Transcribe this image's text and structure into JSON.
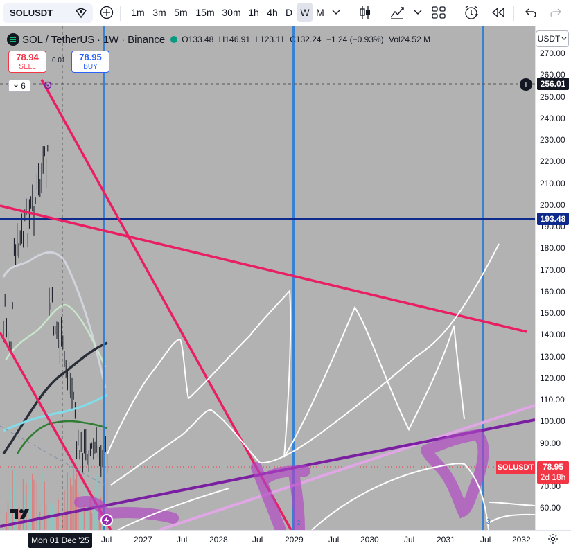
{
  "toolbar": {
    "symbol": "SOLUSDT",
    "intervals": [
      "1m",
      "3m",
      "5m",
      "15m",
      "30m",
      "1h",
      "4h",
      "D",
      "W",
      "M"
    ],
    "active_interval": "W"
  },
  "legend": {
    "pair": "SOL / TetherUS",
    "interval": "1W",
    "exchange": "Binance",
    "o_label": "O",
    "o": "133.48",
    "h_label": "H",
    "h": "146.91",
    "l_label": "L",
    "l": "123.11",
    "c_label": "C",
    "c": "132.24",
    "change": "−1.24 (−0.93%)",
    "vol_label": "Vol",
    "vol": "24.52 M"
  },
  "trade": {
    "sell_price": "78.94",
    "sell_label": "SELL",
    "buy_price": "78.95",
    "buy_label": "BUY",
    "spread": "0.01"
  },
  "indicators_count": "6",
  "right_axis": {
    "currency": "USDT",
    "ticks": [
      "270.00",
      "260.00",
      "250.00",
      "240.00",
      "230.00",
      "220.00",
      "210.00",
      "200.00",
      "190.00",
      "180.00",
      "170.00",
      "160.00",
      "150.00",
      "140.00",
      "130.00",
      "120.00",
      "110.00",
      "100.00",
      "90.00",
      "80.00",
      "70.00",
      "60.00"
    ],
    "crosshair_price": "256.01",
    "level_price": "193.48",
    "last_price": "78.95",
    "countdown": "2d 18h",
    "symbol_flag": "SOLUSDT"
  },
  "bottom_axis": {
    "crosshair_date": "Mon 01 Dec '25",
    "ticks": [
      "Jul",
      "2027",
      "Jul",
      "2028",
      "Jul",
      "2029",
      "Jul",
      "2030",
      "Jul",
      "2031",
      "Jul",
      "2032"
    ]
  },
  "markers": [
    "2",
    "3"
  ],
  "colors": {
    "chart_bg": "#b2b2b2",
    "pink_line": "#e91e63",
    "purple_line": "#7b1fa2",
    "lavender_line": "#e1a6e6",
    "blue_vertical": "#2a7dd6",
    "navy_level": "#0d2a8c",
    "down": "#f23645"
  }
}
